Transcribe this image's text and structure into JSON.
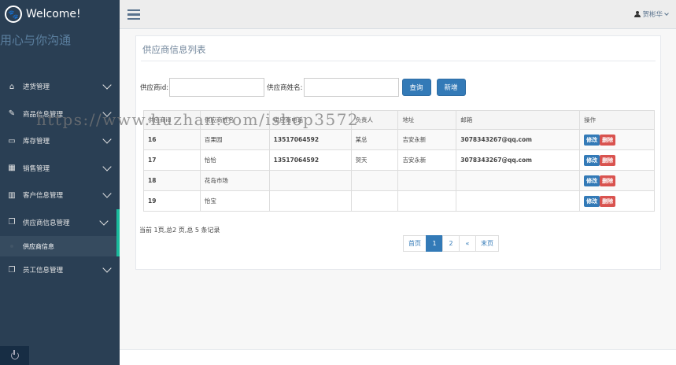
{
  "brand": {
    "title": "Welcome!",
    "slogan": "用心与你沟通"
  },
  "sidebar": {
    "items": [
      {
        "icon": "home-icon",
        "label": "进货管理"
      },
      {
        "icon": "edit-icon",
        "label": "商品信息管理"
      },
      {
        "icon": "desktop-icon",
        "label": "库存管理"
      },
      {
        "icon": "table-icon",
        "label": "销售管理"
      },
      {
        "icon": "bar-chart-icon",
        "label": "客户信息管理"
      },
      {
        "icon": "clone-icon",
        "label": "供应商信息管理"
      },
      {
        "icon": "clone-icon",
        "label": "员工信息管理"
      }
    ],
    "submenu": {
      "label": "供应商信息"
    }
  },
  "topbar": {
    "user": "贺彬华"
  },
  "panel": {
    "title": "供应商信息列表"
  },
  "search": {
    "id_label": "供应商id:",
    "name_label": "供应商姓名:",
    "query_label": "查询",
    "add_label": "新增"
  },
  "table": {
    "headers": [
      "供应商id",
      "供应商姓名",
      "供应商电话",
      "负责人",
      "地址",
      "邮箱",
      "操作"
    ],
    "rows": [
      {
        "id": "16",
        "name": "百果园",
        "phone": "13517064592",
        "owner": "某总",
        "address": "吉安永新",
        "email": "3078343267@qq.com"
      },
      {
        "id": "17",
        "name": "恰恰",
        "phone": "13517064592",
        "owner": "贺天",
        "address": "吉安永新",
        "email": "3078343267@qq.com"
      },
      {
        "id": "18",
        "name": "花岛市场",
        "phone": "",
        "owner": "",
        "address": "",
        "email": ""
      },
      {
        "id": "19",
        "name": "怡宝",
        "phone": "",
        "owner": "",
        "address": "",
        "email": ""
      }
    ],
    "edit_label": "修改",
    "delete_label": "删除"
  },
  "pagination": {
    "info": "当前 1页,总2 页,总 5 条记录",
    "first": "首页",
    "pages": [
      "1",
      "2"
    ],
    "prev": "«",
    "last": "末页"
  },
  "watermark": "https://www.huzhan.com/ishop3572",
  "colors": {
    "sidebar": "#2a3f54",
    "accent": "#1abb9c",
    "primary": "#337ab7",
    "danger": "#d9534f"
  }
}
